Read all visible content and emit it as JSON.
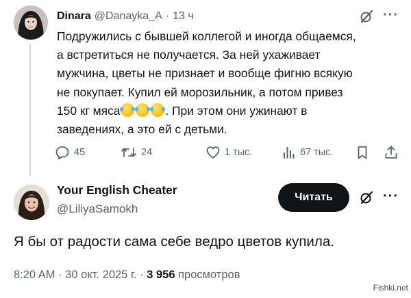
{
  "tweet1": {
    "author_name": "Dinara",
    "author_handle": "@Danayka_A",
    "separator": "·",
    "time": "13 ч",
    "lines": [
      "Подружились с бывшей коллегой и иногда общаемся,",
      "а встретиться не получается. За ней ухаживает",
      "мужчина, цветы не признает и вообще фигню всякую",
      "не покупает. Купил ей морозильник, а потом привез"
    ],
    "line5_before": "150 кг мяса",
    "line5_after": ". При этом они ужинают в",
    "line6": "заведениях, а это ей с детьми.",
    "emoji_name": "face-with-tears-of-joy-emoji",
    "actions": {
      "replies": "45",
      "retweets": "24",
      "likes": "1 тыс.",
      "views": "67 тыс."
    }
  },
  "tweet2": {
    "author_name": "Your English Cheater",
    "author_handle": "@LiliyaSamokh",
    "follow_label": "Читать",
    "text": "Я бы от радости сама себе ведро цветов купила.",
    "time": "8:20 AM",
    "separator": "·",
    "date": "30 окт. 2025 г.",
    "views_count": "3 956",
    "views_label": "просмотров"
  },
  "icons": {
    "more": "···",
    "grok": "grok-icon",
    "reply": "reply-icon",
    "retweet": "retweet-icon",
    "like": "heart-icon",
    "views": "views-chart-icon",
    "bookmark": "bookmark-icon",
    "share": "share-icon"
  },
  "colors": {
    "text_primary": "#0f1419",
    "text_secondary": "#536471",
    "button_bg": "#0f1419",
    "button_text": "#ffffff",
    "thread_line": "#cfd9de"
  },
  "watermark": "Fishki.net"
}
